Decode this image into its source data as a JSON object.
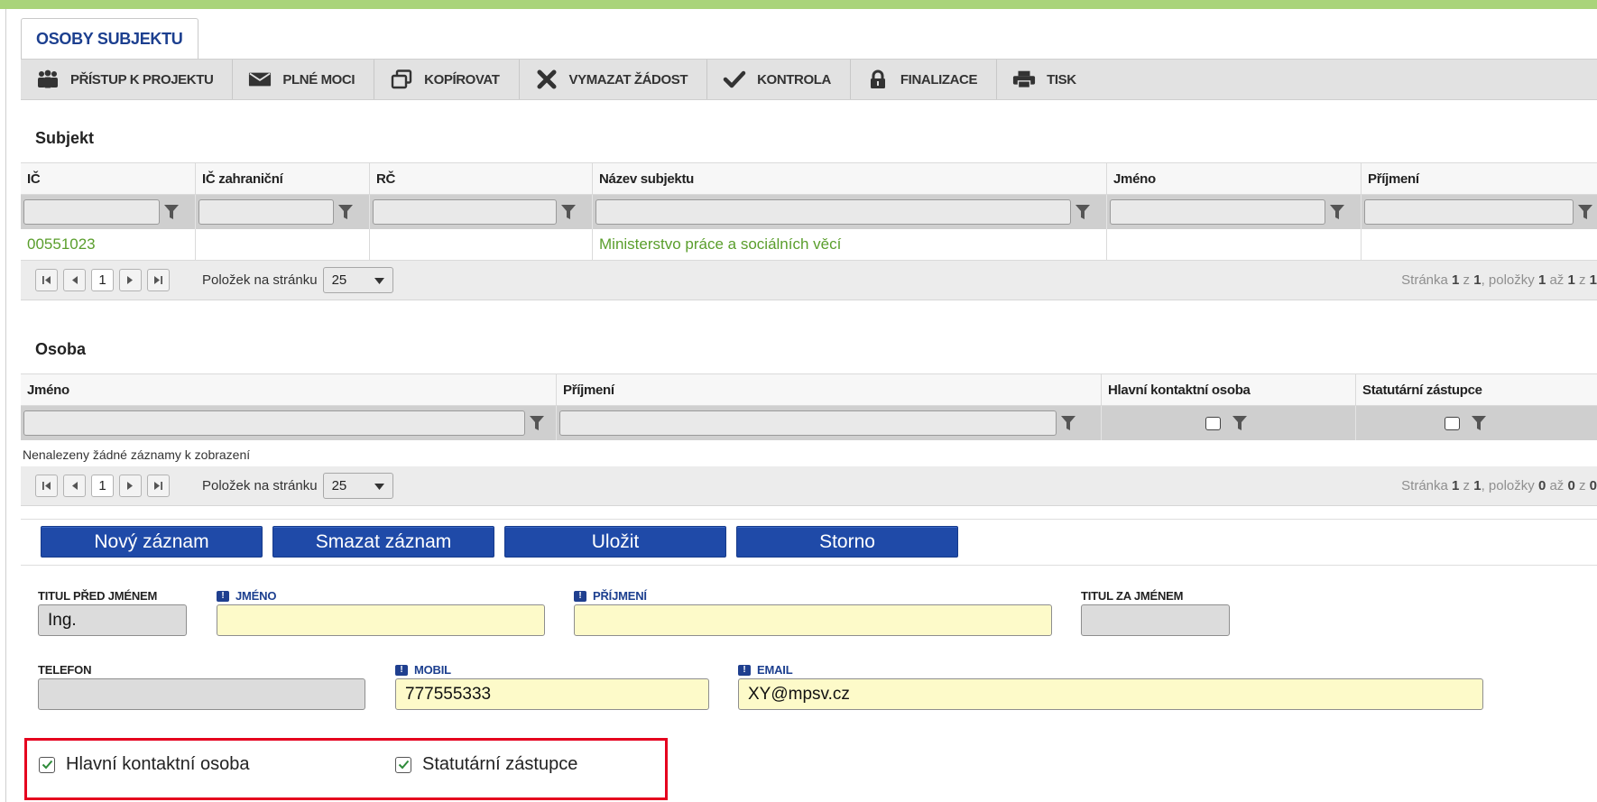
{
  "tab": {
    "label": "OSOBY SUBJEKTU"
  },
  "toolbar": {
    "items": [
      {
        "label": "PŘÍSTUP K PROJEKTU",
        "icon": "people-icon"
      },
      {
        "label": "PLNÉ MOCI",
        "icon": "envelope-icon"
      },
      {
        "label": "KOPÍROVAT",
        "icon": "copy-icon"
      },
      {
        "label": "VYMAZAT ŽÁDOST",
        "icon": "close-icon"
      },
      {
        "label": "KONTROLA",
        "icon": "check-icon"
      },
      {
        "label": "FINALIZACE",
        "icon": "lock-icon"
      },
      {
        "label": "TISK",
        "icon": "printer-icon"
      }
    ]
  },
  "subjekt": {
    "title": "Subjekt",
    "columns": [
      "IČ",
      "IČ zahraniční",
      "RČ",
      "Název subjektu",
      "Jméno",
      "Příjmení"
    ],
    "rows": [
      [
        "00551023",
        "",
        "",
        "Ministerstvo práce a sociálních věcí",
        "",
        ""
      ]
    ],
    "pager": {
      "current_page": "1",
      "per_page_label": "Položek na stránku",
      "per_page_value": "25",
      "info_prefix": "Stránka ",
      "info_page": "1",
      "info_of": " z ",
      "info_pages": "1",
      "info_items": ", položky ",
      "info_from": "1",
      "info_to_word": " až ",
      "info_to": "1",
      "info_total_word": " z ",
      "info_total": "1"
    }
  },
  "osoba": {
    "title": "Osoba",
    "columns": [
      "Jméno",
      "Příjmení",
      "Hlavní kontaktní osoba",
      "Statutární zástupce"
    ],
    "empty_text": "Nenalezeny žádné záznamy k zobrazení",
    "pager": {
      "current_page": "1",
      "per_page_label": "Položek na stránku",
      "per_page_value": "25",
      "info_prefix": "Stránka ",
      "info_page": "1",
      "info_of": " z ",
      "info_pages": "1",
      "info_items": ", položky ",
      "info_from": "0",
      "info_to_word": " až ",
      "info_to": "0",
      "info_total_word": " z ",
      "info_total": "0"
    }
  },
  "actions": {
    "new": "Nový záznam",
    "delete": "Smazat záznam",
    "save": "Uložit",
    "cancel": "Storno"
  },
  "form": {
    "titul_pred": {
      "label": "TITUL PŘED JMÉNEM",
      "value": "Ing."
    },
    "jmeno": {
      "label": "JMÉNO",
      "value": ""
    },
    "prijmeni": {
      "label": "PŘÍJMENÍ",
      "value": ""
    },
    "titul_za": {
      "label": "TITUL ZA JMÉNEM",
      "value": ""
    },
    "telefon": {
      "label": "TELEFON",
      "value": ""
    },
    "mobil": {
      "label": "MOBIL",
      "value": "777555333"
    },
    "email": {
      "label": "EMAIL",
      "value": "XY@mpsv.cz"
    },
    "required_marker": "!"
  },
  "checkboxes": {
    "hlavni": {
      "label": "Hlavní kontaktní osoba",
      "checked": true
    },
    "statutarni": {
      "label": "Statutární zástupce",
      "checked": true
    }
  },
  "colors": {
    "accent": "#1f4aa8",
    "link_green": "#5a9e2c",
    "highlight": "#e5001e",
    "topbar": "#a9d47a"
  }
}
